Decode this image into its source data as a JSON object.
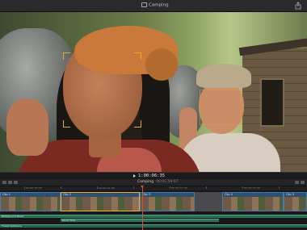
{
  "window": {
    "library_title": "Camping"
  },
  "transport": {
    "timecode": "1:00:06:35"
  },
  "timeline": {
    "project_name": "Camping",
    "project_duration": "00:01:59:07",
    "ruler_labels": [
      "00:00:05:00",
      "00:00:10:00",
      "00:00:15:00",
      "00:00:20:00"
    ],
    "clips": [
      "Clip 1",
      "Clip 2",
      "Clip 3",
      "Clip 4",
      "Clip 5",
      "Clip 6"
    ],
    "audio_clips": [
      "Background Music",
      "Room Tone",
      "Forest Ambience"
    ]
  },
  "viewer": {
    "face_detection": "active"
  },
  "colors": {
    "accent": "#e6b23a",
    "playhead": "#e24b3b",
    "clip": "#2f4f6e",
    "audio": "#2e6f58"
  }
}
